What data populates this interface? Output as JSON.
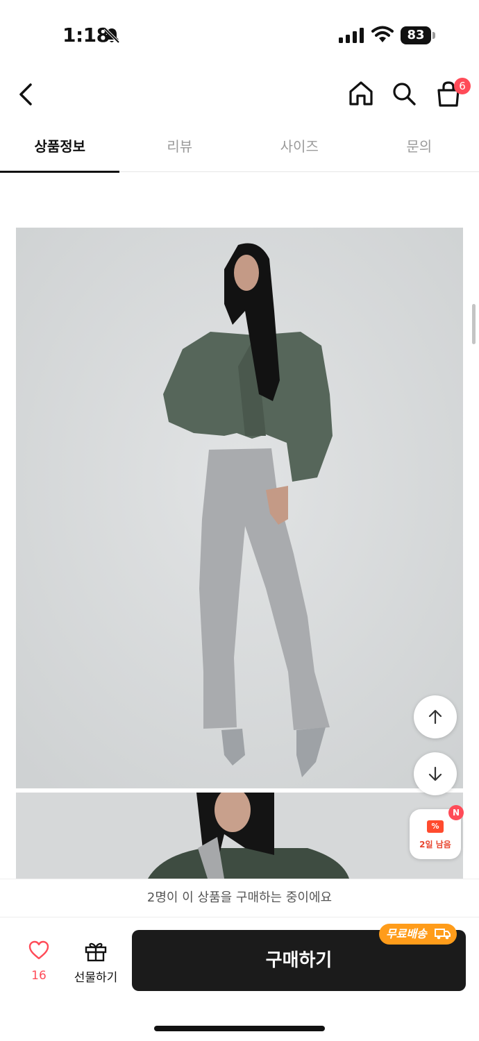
{
  "status_bar": {
    "time": "1:18",
    "battery": "83"
  },
  "header": {
    "cart_count": "6"
  },
  "tabs": [
    {
      "label": "상품정보",
      "active": true
    },
    {
      "label": "리뷰",
      "active": false
    },
    {
      "label": "사이즈",
      "active": false
    },
    {
      "label": "문의",
      "active": false
    }
  ],
  "coupon": {
    "badge": "N",
    "icon_text": "%",
    "label": "2일 남음"
  },
  "notice": {
    "text": "2명이 이 상품을 구매하는 중이에요"
  },
  "bottom_bar": {
    "like_count": "16",
    "gift_label": "선물하기",
    "buy_label": "구매하기",
    "free_shipping_label": "무료배송"
  },
  "colors": {
    "accent_red": "#ff4b58",
    "free_shipping_orange": "#ff9c1a",
    "buy_button": "#1b1b1b"
  }
}
